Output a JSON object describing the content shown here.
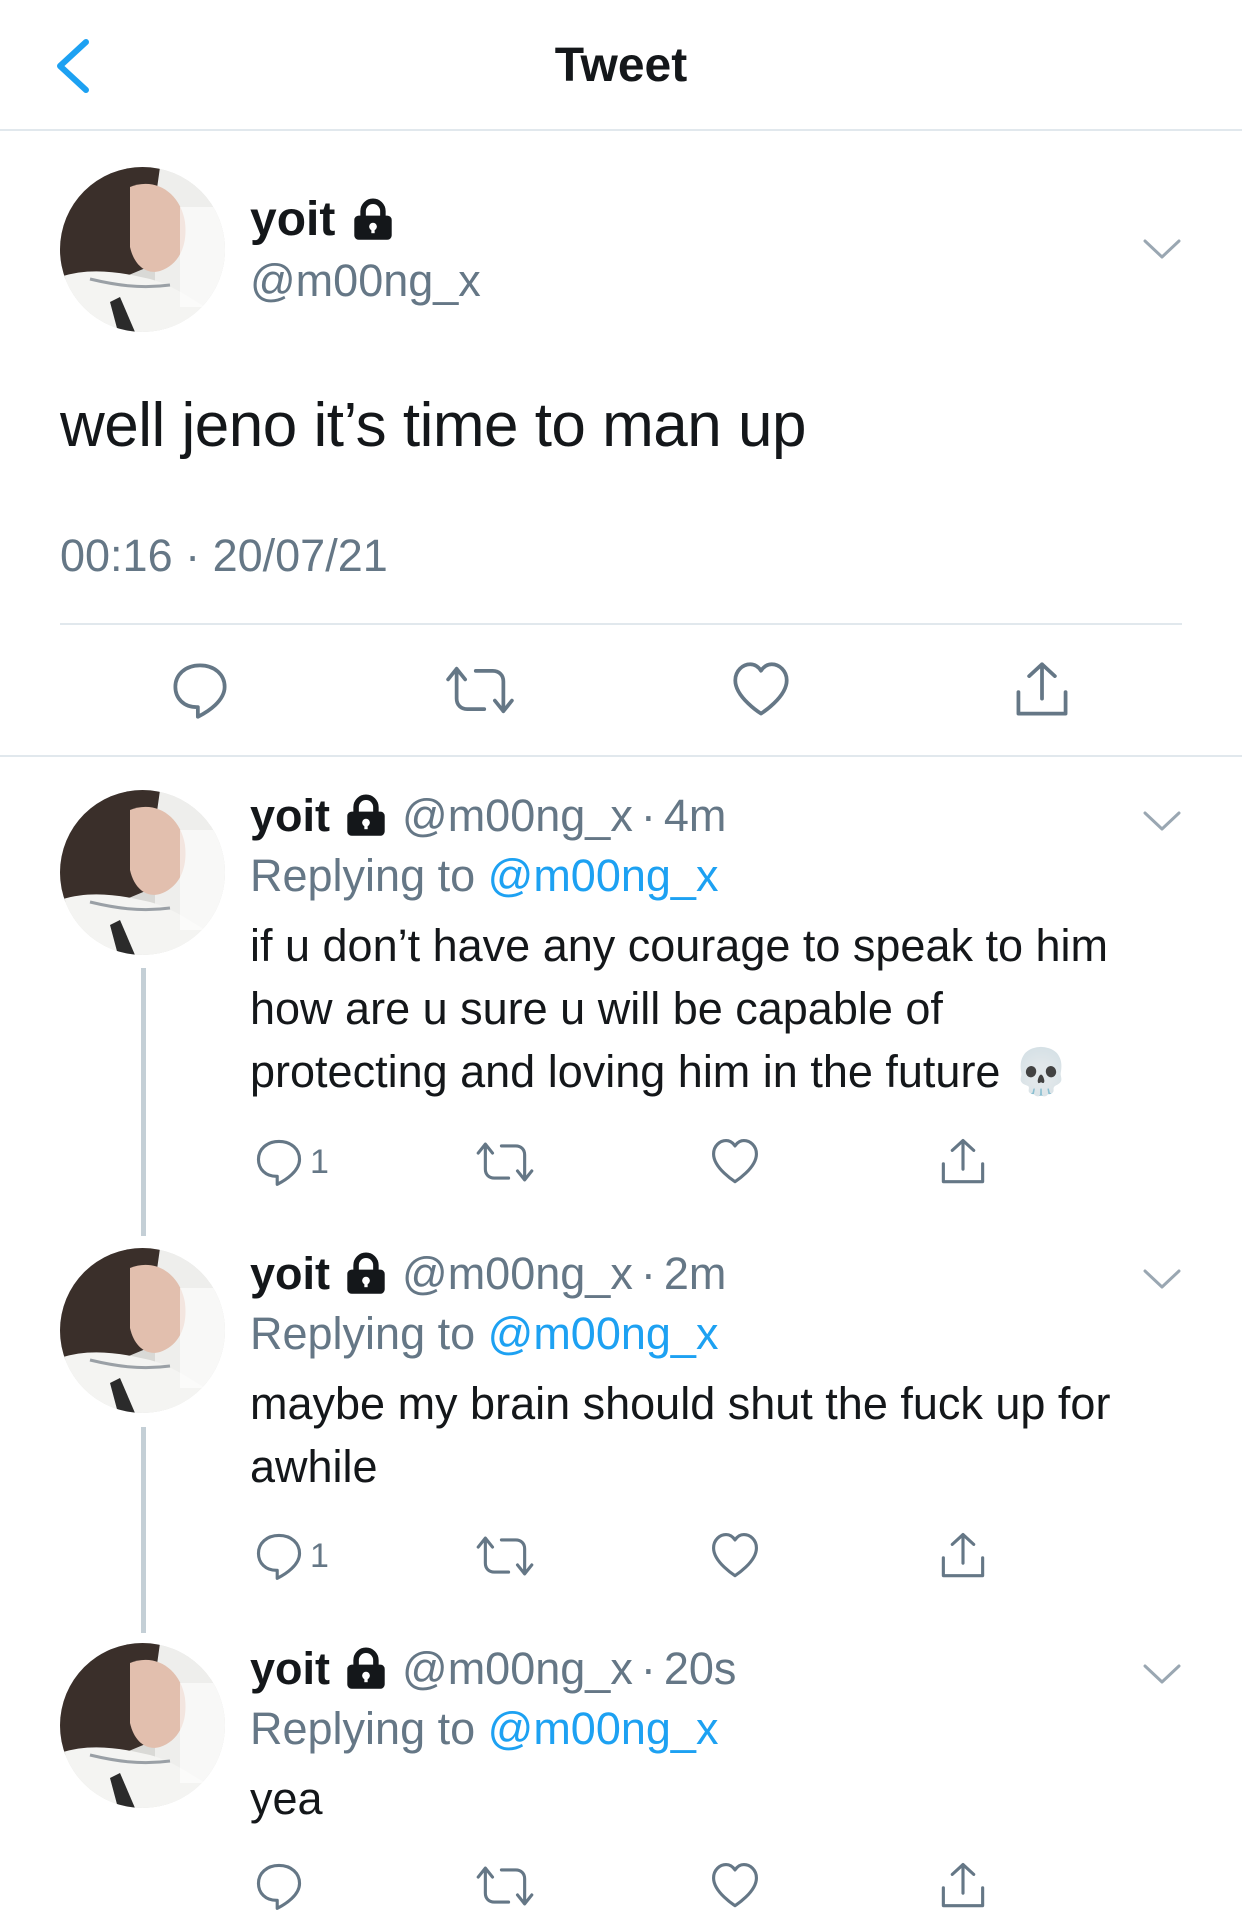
{
  "header": {
    "title": "Tweet",
    "back_icon": "chevron-left-icon"
  },
  "colors": {
    "accent": "#1da1f2",
    "secondary_text": "#657786",
    "divider": "#e1e8ed"
  },
  "main_tweet": {
    "name": "yoit",
    "handle": "@m00ng_x",
    "text": "well jeno it’s time to man up",
    "timestamp": "00:16 · 20/07/21",
    "actions": [
      "reply-icon",
      "retweet-icon",
      "like-icon",
      "share-icon"
    ]
  },
  "replies": [
    {
      "name": "yoit",
      "handle": "@m00ng_x",
      "dot": "·",
      "age": "4m",
      "replying_prefix": "Replying to ",
      "replying_to": "@m00ng_x",
      "text": "if u don’t have any courage to speak to him how are u sure u will be capable of protecting and loving him in the future 💀",
      "reply_count": "1"
    },
    {
      "name": "yoit",
      "handle": "@m00ng_x",
      "dot": "·",
      "age": "2m",
      "replying_prefix": "Replying to ",
      "replying_to": "@m00ng_x",
      "text": "maybe my brain should shut the fuck up for awhile",
      "reply_count": "1"
    },
    {
      "name": "yoit",
      "handle": "@m00ng_x",
      "dot": "·",
      "age": "20s",
      "replying_prefix": "Replying to ",
      "replying_to": "@m00ng_x",
      "text": "yea",
      "reply_count": ""
    }
  ]
}
